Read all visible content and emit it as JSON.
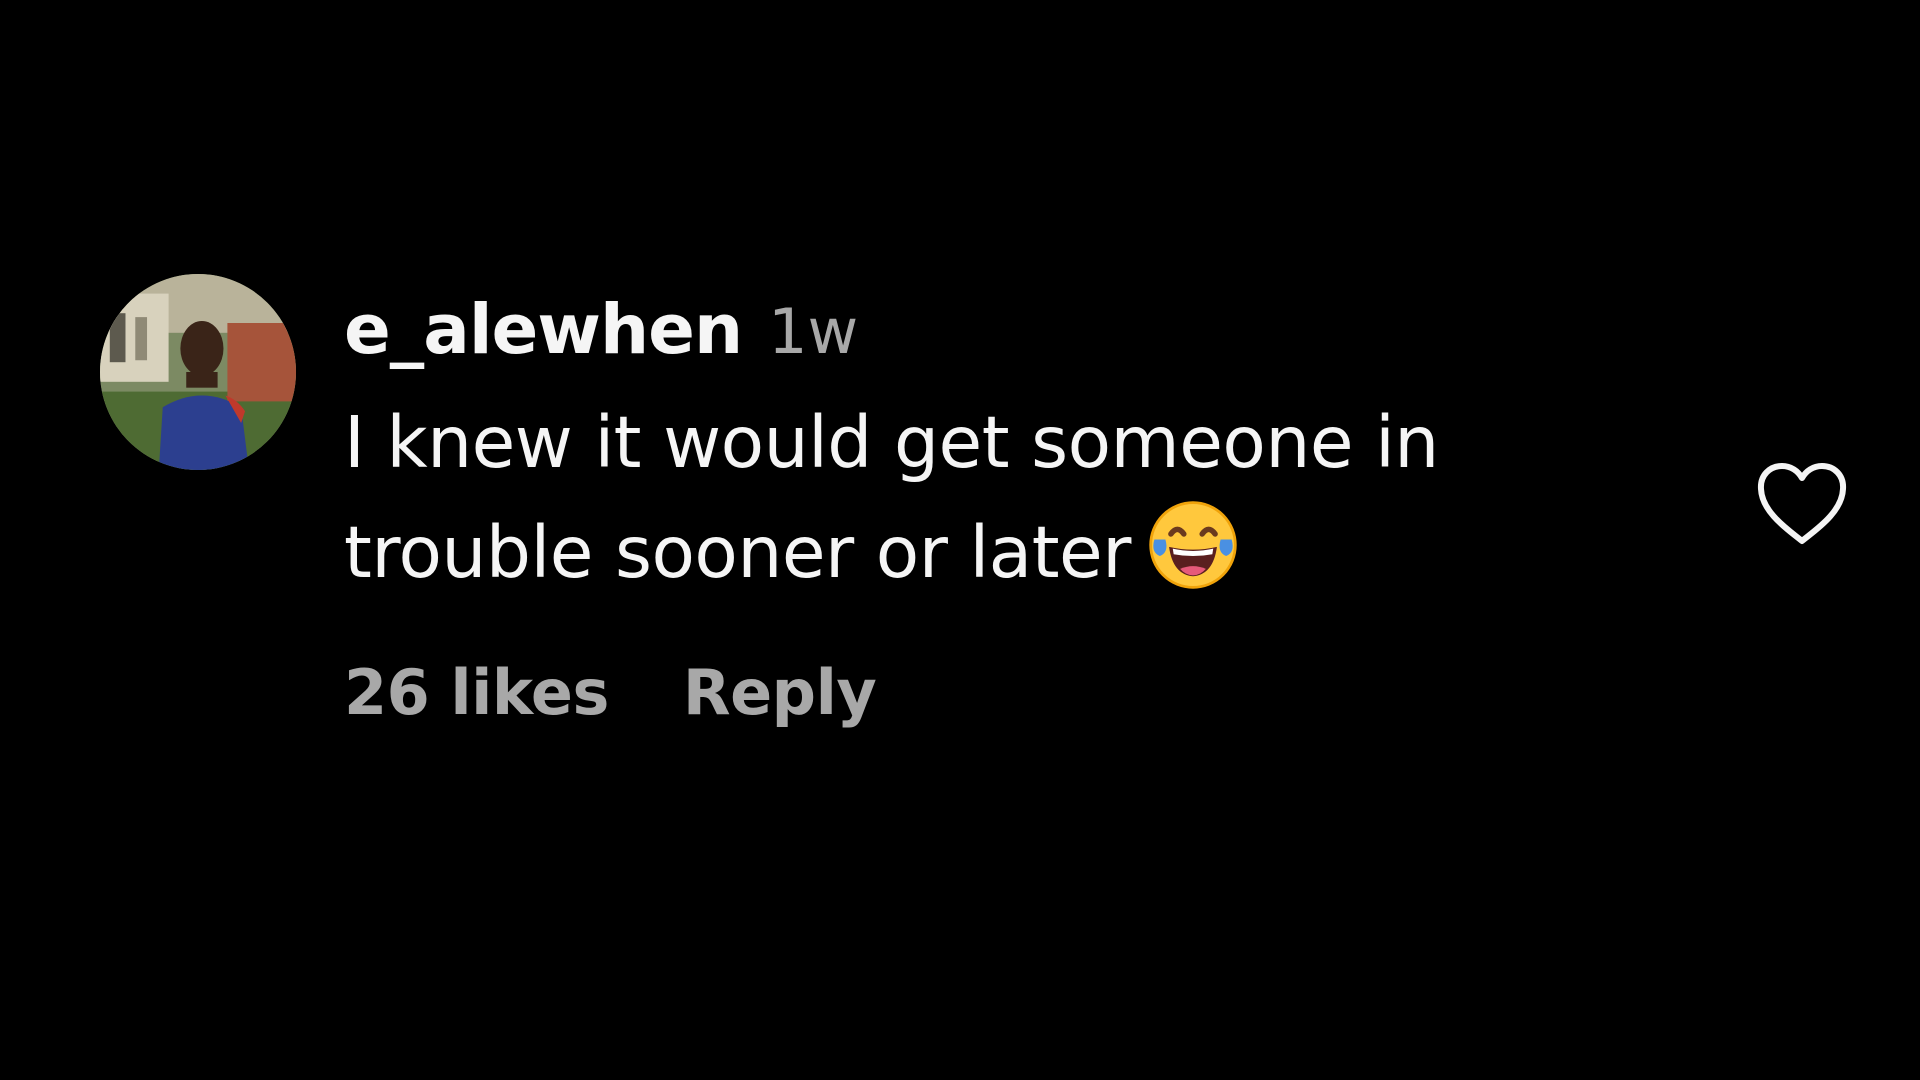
{
  "comment": {
    "username": "e_alewhen",
    "timestamp": "1w",
    "text_lines": [
      "I knew it would get someone in",
      "trouble sooner or later"
    ],
    "emoji": "face-with-tears-of-joy-icon",
    "likes_label": "26 likes",
    "reply_label": "Reply",
    "like_icon": "heart-outline-icon"
  },
  "colors": {
    "background": "#000000",
    "primary_text": "#f5f5f5",
    "secondary_text": "#a8a8a8"
  }
}
